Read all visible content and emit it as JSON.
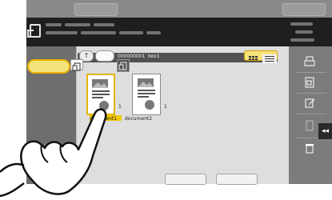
{
  "path": {
    "box_number": "000000001",
    "box_name": "box1"
  },
  "documents": [
    {
      "name": "document1",
      "count": "1",
      "selected": true
    },
    {
      "name": "document2",
      "count": "1",
      "selected": false
    }
  ],
  "view_modes": [
    "thumbnail-view",
    "list-view"
  ],
  "right_toolbar": {
    "icons": [
      "print-icon",
      "scan-icon",
      "edit-icon",
      "save-icon",
      "delete-icon"
    ],
    "collapse_tab": "◂◂"
  },
  "up_button": "↑",
  "accent": "#e6b400"
}
